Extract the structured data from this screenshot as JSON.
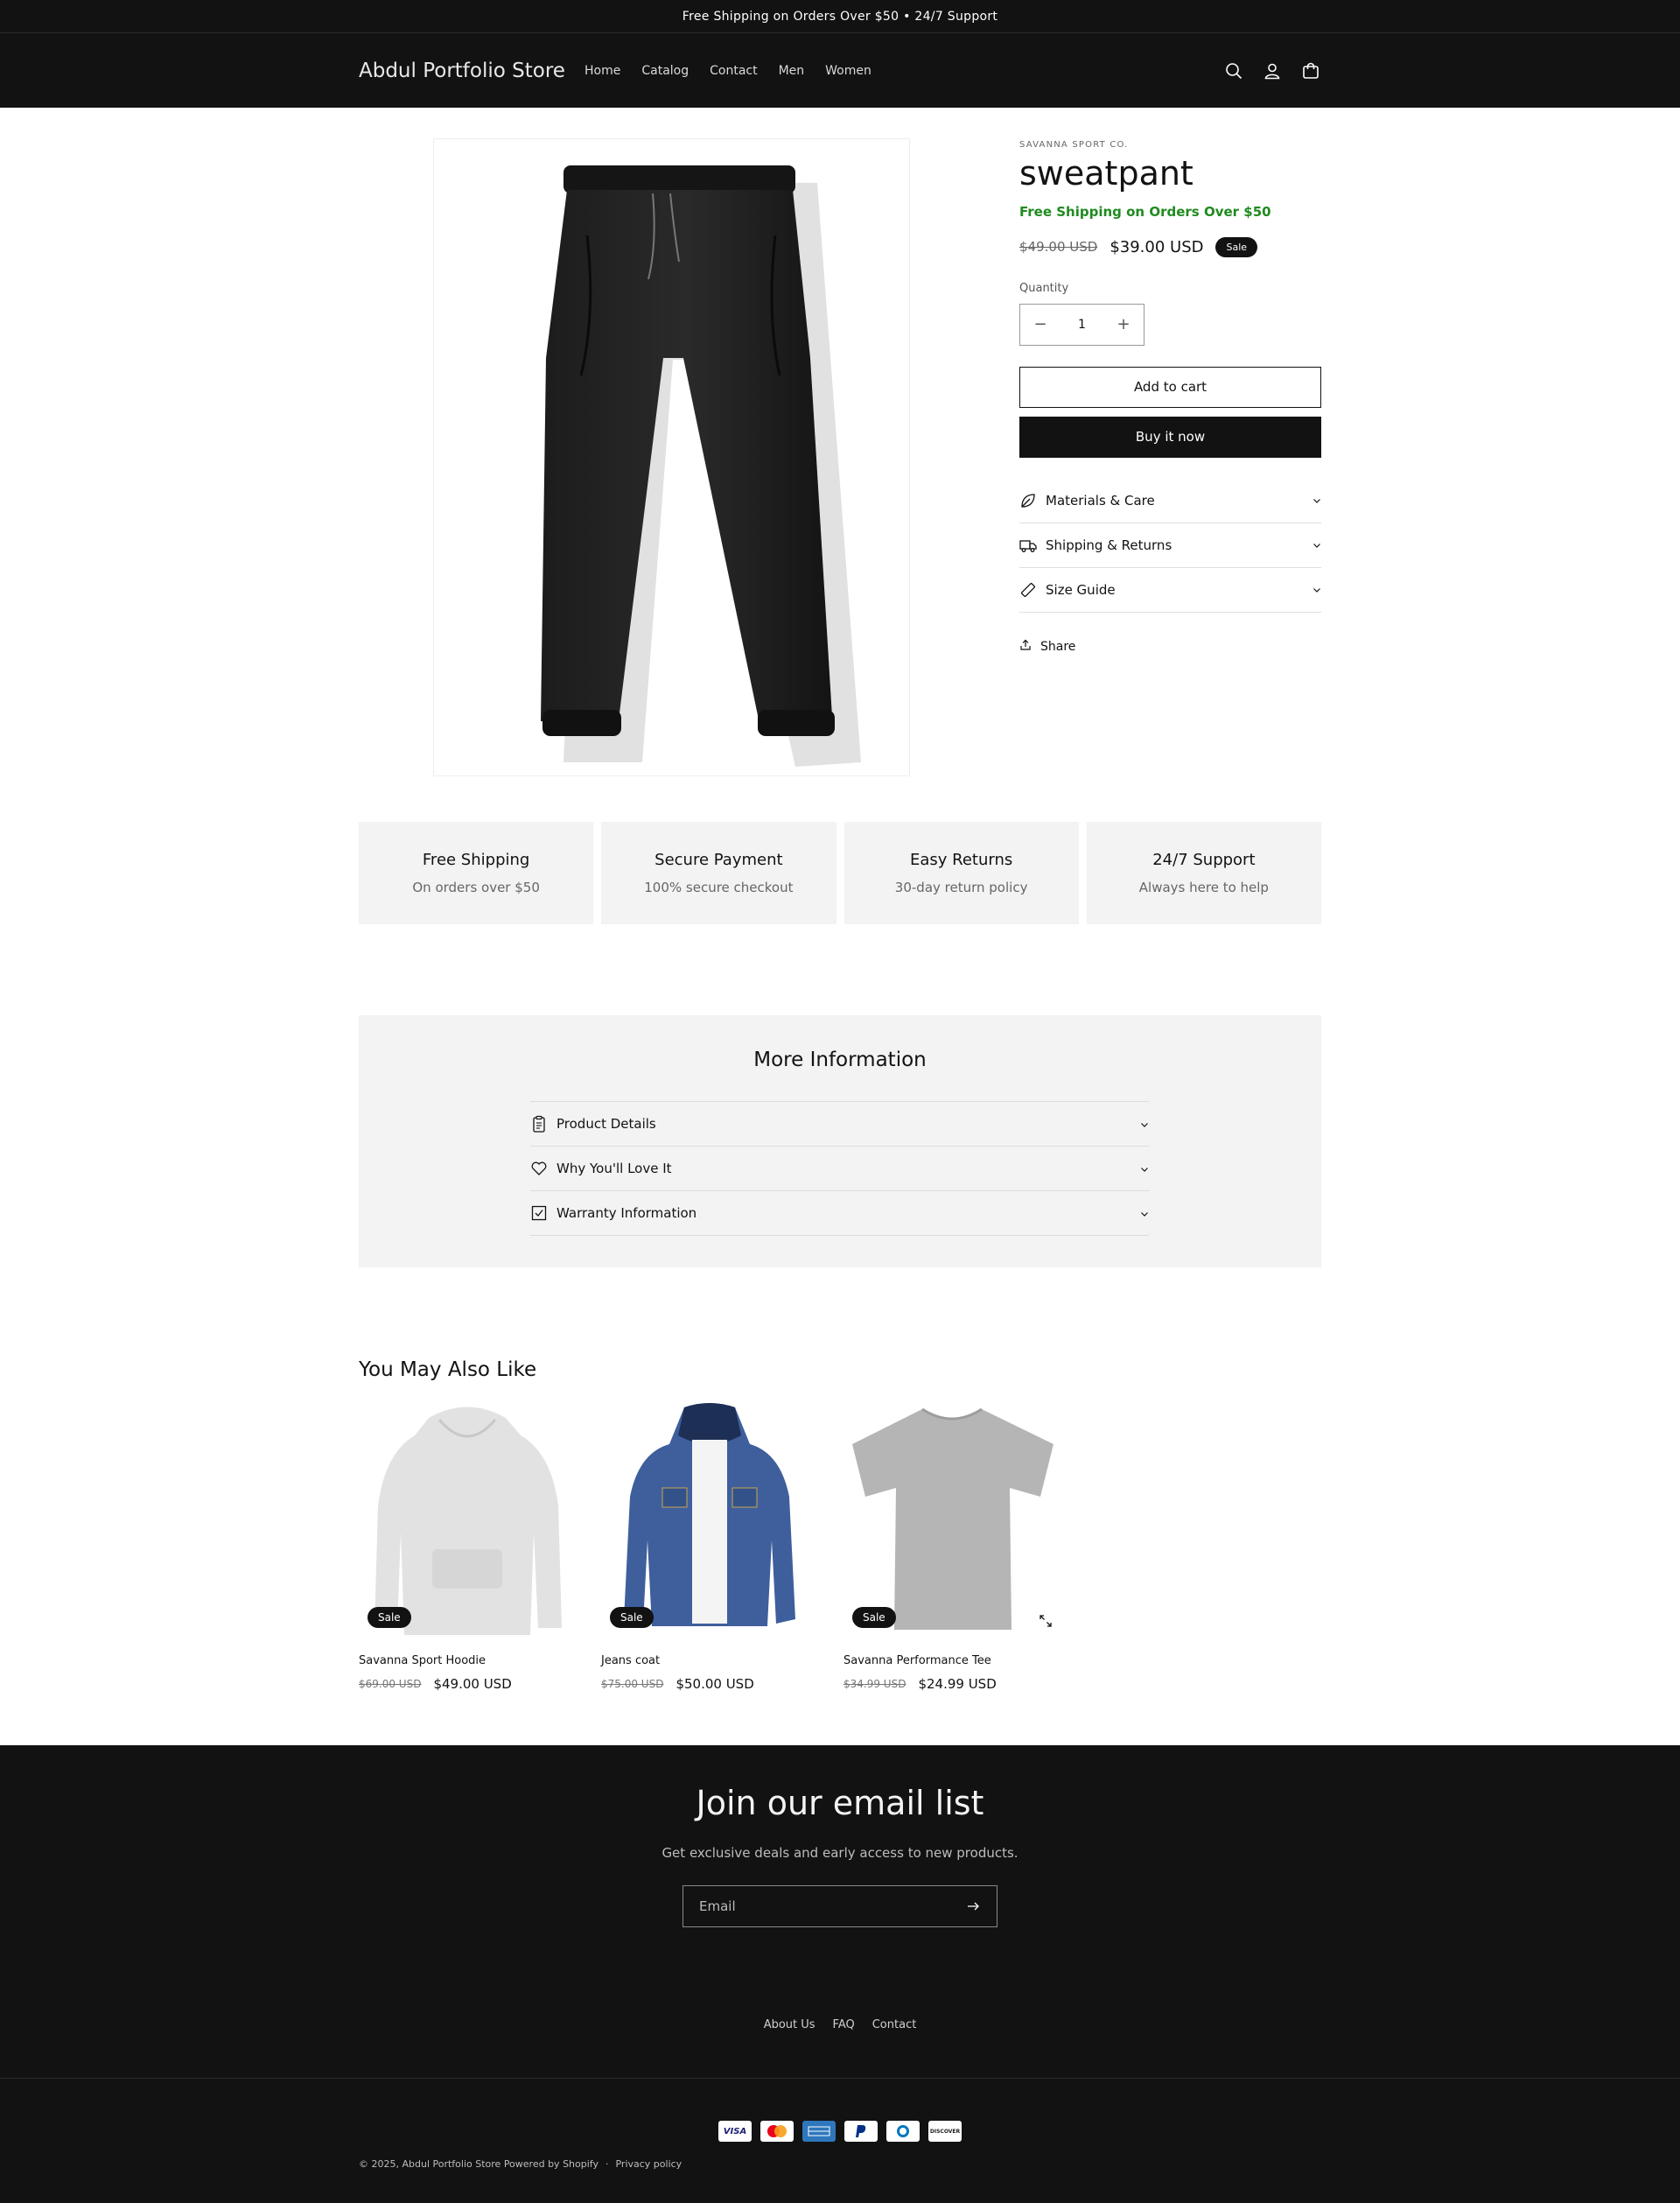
{
  "announcement": "Free Shipping on Orders Over $50 • 24/7 Support",
  "header": {
    "brand": "Abdul Portfolio Store",
    "nav": [
      "Home",
      "Catalog",
      "Contact",
      "Men",
      "Women"
    ],
    "icons": [
      "search-icon",
      "account-icon",
      "cart-icon"
    ]
  },
  "product": {
    "vendor": "SAVANNA SPORT CO.",
    "title": "sweatpant",
    "shipping_note": "Free Shipping on Orders Over $50",
    "price_old": "$49.00 USD",
    "price_new": "$39.00 USD",
    "badge": "Sale",
    "quantity_label": "Quantity",
    "quantity": "1",
    "add_to_cart": "Add to cart",
    "buy_now": "Buy it now",
    "accordions": [
      {
        "label": "Materials & Care",
        "icon": "leaf-icon"
      },
      {
        "label": "Shipping & Returns",
        "icon": "truck-icon"
      },
      {
        "label": "Size Guide",
        "icon": "ruler-icon"
      }
    ],
    "share": "Share"
  },
  "features": [
    {
      "title": "Free Shipping",
      "subtitle": "On orders over $50"
    },
    {
      "title": "Secure Payment",
      "subtitle": "100% secure checkout"
    },
    {
      "title": "Easy Returns",
      "subtitle": "30-day return policy"
    },
    {
      "title": "24/7 Support",
      "subtitle": "Always here to help"
    }
  ],
  "more_info": {
    "title": "More Information",
    "items": [
      {
        "label": "Product Details",
        "icon": "clipboard-icon"
      },
      {
        "label": "Why You'll Love It",
        "icon": "heart-icon"
      },
      {
        "label": "Warranty Information",
        "icon": "checkbox-icon"
      }
    ]
  },
  "related": {
    "title": "You May Also Like",
    "items": [
      {
        "name": "Savanna Sport Hoodie",
        "price_old": "$69.00 USD",
        "price_new": "$49.00 USD",
        "badge": "Sale"
      },
      {
        "name": "Jeans coat",
        "price_old": "$75.00 USD",
        "price_new": "$50.00 USD",
        "badge": "Sale"
      },
      {
        "name": "Savanna Performance Tee",
        "price_old": "$34.99 USD",
        "price_new": "$24.99 USD",
        "badge": "Sale"
      }
    ]
  },
  "footer": {
    "title": "Join our email list",
    "subtitle": "Get exclusive deals and early access to new products.",
    "email_placeholder": "Email",
    "links": [
      "About Us",
      "FAQ",
      "Contact"
    ],
    "payments": [
      "VISA",
      "MC",
      "AMEX",
      "PayPal",
      "Diners",
      "DISCOVER"
    ],
    "copyright": "© 2025, Abdul Portfolio Store Powered by Shopify",
    "separator": "·",
    "privacy": "Privacy policy"
  }
}
